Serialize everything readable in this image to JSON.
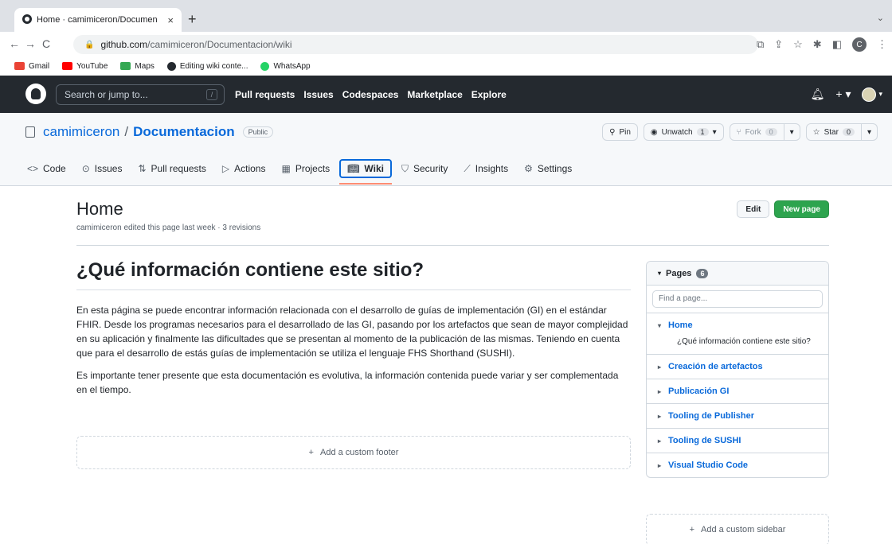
{
  "browser": {
    "tab_title": "Home · camimiceron/Documen",
    "tab_close": "×",
    "new_tab": "+",
    "url_host": "github.com",
    "url_path": "/camimiceron/Documentacion/wiki",
    "profile_initial": "C",
    "bookmarks": [
      {
        "label": "Gmail",
        "color": "#ea4335"
      },
      {
        "label": "YouTube",
        "color": "#ff0000"
      },
      {
        "label": "Maps",
        "color": "#34a853"
      },
      {
        "label": "Editing wiki conte...",
        "color": "#24292f"
      },
      {
        "label": "WhatsApp",
        "color": "#25d366"
      }
    ]
  },
  "gh": {
    "search_placeholder": "Search or jump to...",
    "search_key": "/",
    "nav": [
      "Pull requests",
      "Issues",
      "Codespaces",
      "Marketplace",
      "Explore"
    ]
  },
  "repo": {
    "owner": "camimiceron",
    "name": "Documentacion",
    "visibility": "Public",
    "pin": "Pin",
    "unwatch": "Unwatch",
    "watch_count": "1",
    "fork": "Fork",
    "fork_count": "0",
    "star": "Star",
    "star_count": "0",
    "tabs": [
      "Code",
      "Issues",
      "Pull requests",
      "Actions",
      "Projects",
      "Wiki",
      "Security",
      "Insights",
      "Settings"
    ]
  },
  "wiki": {
    "title": "Home",
    "meta": "camimiceron edited this page last week · 3 revisions",
    "edit": "Edit",
    "new_page": "New page",
    "heading": "¿Qué información contiene este sitio?",
    "para1": "En esta página se puede encontrar información relacionada con el desarrollo de guías de implementación (GI) en el estándar FHIR. Desde los programas necesarios para el desarrollado de las GI, pasando por los artefactos que sean de mayor complejidad en su aplicación y finalmente las dificultades que se presentan al momento de la publicación de las mismas. Teniendo en cuenta que para el desarrollo de estás guías de implementación se utiliza el lenguaje FHS Shorthand (SUSHI).",
    "para2": "Es importante tener presente que esta documentación es evolutiva, la información contenida puede variar y ser complementada en el tiempo.",
    "add_footer": "Add a custom footer"
  },
  "sidebar": {
    "pages_label": "Pages",
    "pages_count": "6",
    "filter_placeholder": "Find a page...",
    "home": "Home",
    "home_sub": "¿Qué información contiene este sitio?",
    "pages": [
      "Creación de artefactos",
      "Publicación GI",
      "Tooling de Publisher",
      "Tooling de SUSHI",
      "Visual Studio Code"
    ],
    "add_sidebar": "Add a custom sidebar"
  }
}
